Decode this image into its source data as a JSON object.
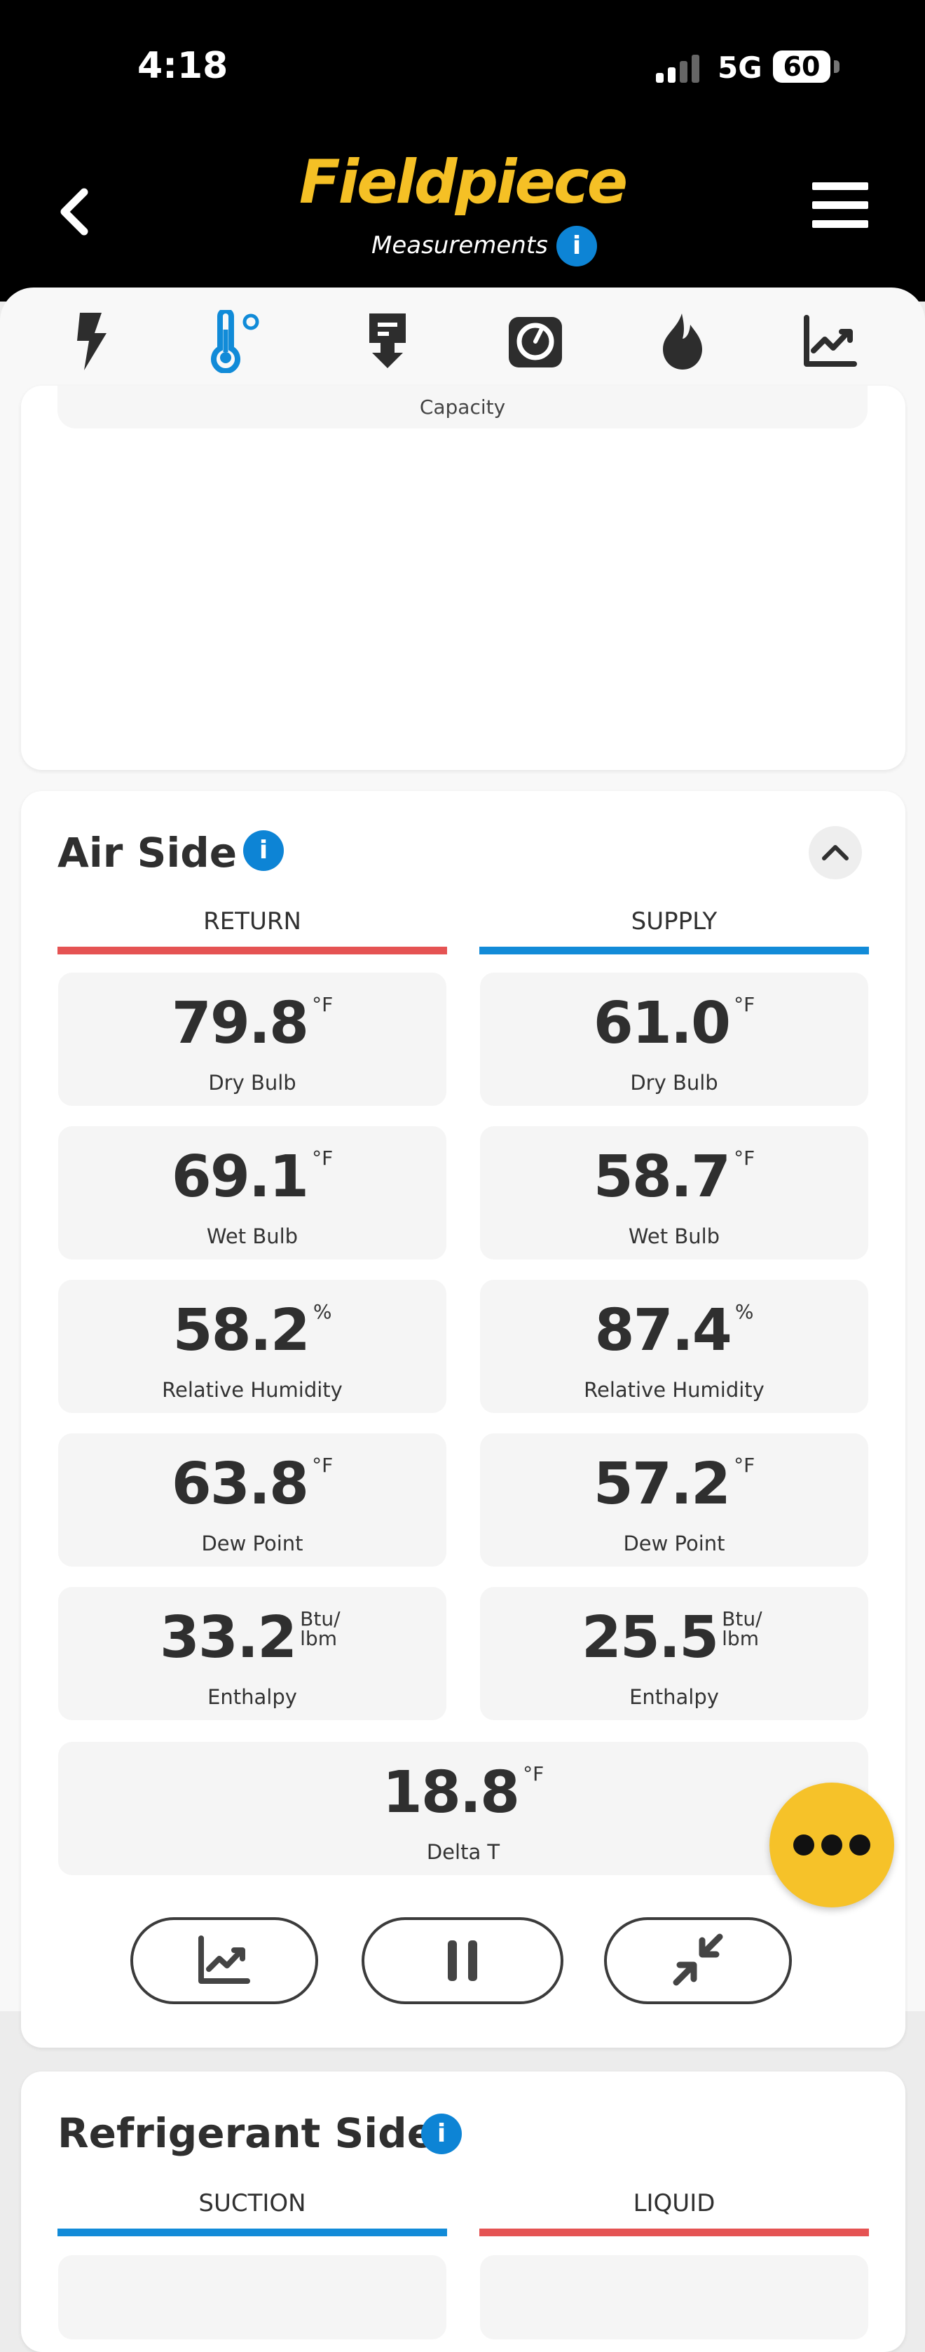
{
  "status": {
    "time": "4:18",
    "network": "5G",
    "battery": "60"
  },
  "header": {
    "brand": "Fieldpiece",
    "subtitle": "Measurements",
    "info": "i"
  },
  "tabs": [
    {
      "icon": "lightning-icon"
    },
    {
      "icon": "thermometer-icon"
    },
    {
      "icon": "download-tab-icon"
    },
    {
      "icon": "gauge-icon"
    },
    {
      "icon": "flame-icon"
    },
    {
      "icon": "trend-chart-icon"
    }
  ],
  "previous_section": {
    "label": "Capacity"
  },
  "air_side": {
    "title": "Air Side",
    "info": "i",
    "columns": {
      "return": "RETURN",
      "supply": "SUPPLY"
    },
    "return": [
      {
        "value": "79.8",
        "unit": "°F",
        "label": "Dry Bulb"
      },
      {
        "value": "69.1",
        "unit": "°F",
        "label": "Wet Bulb"
      },
      {
        "value": "58.2",
        "unit": "%",
        "label": "Relative Humidity"
      },
      {
        "value": "63.8",
        "unit": "°F",
        "label": "Dew Point"
      },
      {
        "value": "33.2",
        "unit": "Btu/ lbm",
        "label": "Enthalpy"
      }
    ],
    "supply": [
      {
        "value": "61.0",
        "unit": "°F",
        "label": "Dry Bulb"
      },
      {
        "value": "58.7",
        "unit": "°F",
        "label": "Wet Bulb"
      },
      {
        "value": "87.4",
        "unit": "%",
        "label": "Relative Humidity"
      },
      {
        "value": "57.2",
        "unit": "°F",
        "label": "Dew Point"
      },
      {
        "value": "25.5",
        "unit": "Btu/ lbm",
        "label": "Enthalpy"
      }
    ],
    "delta_t": {
      "value": "18.8",
      "unit": "°F",
      "label": "Delta T"
    }
  },
  "refrigerant_side": {
    "title": "Refrigerant Side",
    "info": "i",
    "columns": {
      "suction": "SUCTION",
      "liquid": "LIQUID"
    }
  },
  "colors": {
    "brand": "#f5c025",
    "info_blue": "#0d84d5",
    "return_red": "#e55353",
    "supply_blue": "#128bd8",
    "fab": "#f6c229"
  }
}
